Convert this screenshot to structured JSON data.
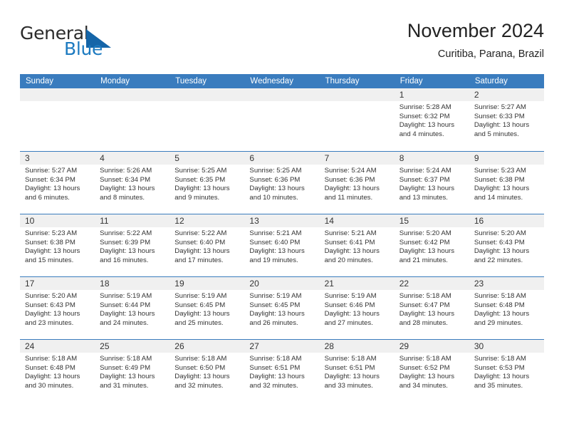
{
  "brand": {
    "name_part1": "General",
    "name_part2": "Blue",
    "accent_color": "#1c7ac0",
    "triangle_color": "#1565a8"
  },
  "header": {
    "title": "November 2024",
    "subtitle": "Curitiba, Parana, Brazil"
  },
  "calendar": {
    "header_bg": "#3a7cbe",
    "daynum_bg": "#f0f0f0",
    "weekdays": [
      "Sunday",
      "Monday",
      "Tuesday",
      "Wednesday",
      "Thursday",
      "Friday",
      "Saturday"
    ],
    "weeks": [
      [
        {
          "day": "",
          "empty": true
        },
        {
          "day": "",
          "empty": true
        },
        {
          "day": "",
          "empty": true
        },
        {
          "day": "",
          "empty": true
        },
        {
          "day": "",
          "empty": true
        },
        {
          "day": "1",
          "sunrise": "Sunrise: 5:28 AM",
          "sunset": "Sunset: 6:32 PM",
          "daylight1": "Daylight: 13 hours",
          "daylight2": "and 4 minutes."
        },
        {
          "day": "2",
          "sunrise": "Sunrise: 5:27 AM",
          "sunset": "Sunset: 6:33 PM",
          "daylight1": "Daylight: 13 hours",
          "daylight2": "and 5 minutes."
        }
      ],
      [
        {
          "day": "3",
          "sunrise": "Sunrise: 5:27 AM",
          "sunset": "Sunset: 6:34 PM",
          "daylight1": "Daylight: 13 hours",
          "daylight2": "and 6 minutes."
        },
        {
          "day": "4",
          "sunrise": "Sunrise: 5:26 AM",
          "sunset": "Sunset: 6:34 PM",
          "daylight1": "Daylight: 13 hours",
          "daylight2": "and 8 minutes."
        },
        {
          "day": "5",
          "sunrise": "Sunrise: 5:25 AM",
          "sunset": "Sunset: 6:35 PM",
          "daylight1": "Daylight: 13 hours",
          "daylight2": "and 9 minutes."
        },
        {
          "day": "6",
          "sunrise": "Sunrise: 5:25 AM",
          "sunset": "Sunset: 6:36 PM",
          "daylight1": "Daylight: 13 hours",
          "daylight2": "and 10 minutes."
        },
        {
          "day": "7",
          "sunrise": "Sunrise: 5:24 AM",
          "sunset": "Sunset: 6:36 PM",
          "daylight1": "Daylight: 13 hours",
          "daylight2": "and 11 minutes."
        },
        {
          "day": "8",
          "sunrise": "Sunrise: 5:24 AM",
          "sunset": "Sunset: 6:37 PM",
          "daylight1": "Daylight: 13 hours",
          "daylight2": "and 13 minutes."
        },
        {
          "day": "9",
          "sunrise": "Sunrise: 5:23 AM",
          "sunset": "Sunset: 6:38 PM",
          "daylight1": "Daylight: 13 hours",
          "daylight2": "and 14 minutes."
        }
      ],
      [
        {
          "day": "10",
          "sunrise": "Sunrise: 5:23 AM",
          "sunset": "Sunset: 6:38 PM",
          "daylight1": "Daylight: 13 hours",
          "daylight2": "and 15 minutes."
        },
        {
          "day": "11",
          "sunrise": "Sunrise: 5:22 AM",
          "sunset": "Sunset: 6:39 PM",
          "daylight1": "Daylight: 13 hours",
          "daylight2": "and 16 minutes."
        },
        {
          "day": "12",
          "sunrise": "Sunrise: 5:22 AM",
          "sunset": "Sunset: 6:40 PM",
          "daylight1": "Daylight: 13 hours",
          "daylight2": "and 17 minutes."
        },
        {
          "day": "13",
          "sunrise": "Sunrise: 5:21 AM",
          "sunset": "Sunset: 6:40 PM",
          "daylight1": "Daylight: 13 hours",
          "daylight2": "and 19 minutes."
        },
        {
          "day": "14",
          "sunrise": "Sunrise: 5:21 AM",
          "sunset": "Sunset: 6:41 PM",
          "daylight1": "Daylight: 13 hours",
          "daylight2": "and 20 minutes."
        },
        {
          "day": "15",
          "sunrise": "Sunrise: 5:20 AM",
          "sunset": "Sunset: 6:42 PM",
          "daylight1": "Daylight: 13 hours",
          "daylight2": "and 21 minutes."
        },
        {
          "day": "16",
          "sunrise": "Sunrise: 5:20 AM",
          "sunset": "Sunset: 6:43 PM",
          "daylight1": "Daylight: 13 hours",
          "daylight2": "and 22 minutes."
        }
      ],
      [
        {
          "day": "17",
          "sunrise": "Sunrise: 5:20 AM",
          "sunset": "Sunset: 6:43 PM",
          "daylight1": "Daylight: 13 hours",
          "daylight2": "and 23 minutes."
        },
        {
          "day": "18",
          "sunrise": "Sunrise: 5:19 AM",
          "sunset": "Sunset: 6:44 PM",
          "daylight1": "Daylight: 13 hours",
          "daylight2": "and 24 minutes."
        },
        {
          "day": "19",
          "sunrise": "Sunrise: 5:19 AM",
          "sunset": "Sunset: 6:45 PM",
          "daylight1": "Daylight: 13 hours",
          "daylight2": "and 25 minutes."
        },
        {
          "day": "20",
          "sunrise": "Sunrise: 5:19 AM",
          "sunset": "Sunset: 6:45 PM",
          "daylight1": "Daylight: 13 hours",
          "daylight2": "and 26 minutes."
        },
        {
          "day": "21",
          "sunrise": "Sunrise: 5:19 AM",
          "sunset": "Sunset: 6:46 PM",
          "daylight1": "Daylight: 13 hours",
          "daylight2": "and 27 minutes."
        },
        {
          "day": "22",
          "sunrise": "Sunrise: 5:18 AM",
          "sunset": "Sunset: 6:47 PM",
          "daylight1": "Daylight: 13 hours",
          "daylight2": "and 28 minutes."
        },
        {
          "day": "23",
          "sunrise": "Sunrise: 5:18 AM",
          "sunset": "Sunset: 6:48 PM",
          "daylight1": "Daylight: 13 hours",
          "daylight2": "and 29 minutes."
        }
      ],
      [
        {
          "day": "24",
          "sunrise": "Sunrise: 5:18 AM",
          "sunset": "Sunset: 6:48 PM",
          "daylight1": "Daylight: 13 hours",
          "daylight2": "and 30 minutes."
        },
        {
          "day": "25",
          "sunrise": "Sunrise: 5:18 AM",
          "sunset": "Sunset: 6:49 PM",
          "daylight1": "Daylight: 13 hours",
          "daylight2": "and 31 minutes."
        },
        {
          "day": "26",
          "sunrise": "Sunrise: 5:18 AM",
          "sunset": "Sunset: 6:50 PM",
          "daylight1": "Daylight: 13 hours",
          "daylight2": "and 32 minutes."
        },
        {
          "day": "27",
          "sunrise": "Sunrise: 5:18 AM",
          "sunset": "Sunset: 6:51 PM",
          "daylight1": "Daylight: 13 hours",
          "daylight2": "and 32 minutes."
        },
        {
          "day": "28",
          "sunrise": "Sunrise: 5:18 AM",
          "sunset": "Sunset: 6:51 PM",
          "daylight1": "Daylight: 13 hours",
          "daylight2": "and 33 minutes."
        },
        {
          "day": "29",
          "sunrise": "Sunrise: 5:18 AM",
          "sunset": "Sunset: 6:52 PM",
          "daylight1": "Daylight: 13 hours",
          "daylight2": "and 34 minutes."
        },
        {
          "day": "30",
          "sunrise": "Sunrise: 5:18 AM",
          "sunset": "Sunset: 6:53 PM",
          "daylight1": "Daylight: 13 hours",
          "daylight2": "and 35 minutes."
        }
      ]
    ]
  }
}
